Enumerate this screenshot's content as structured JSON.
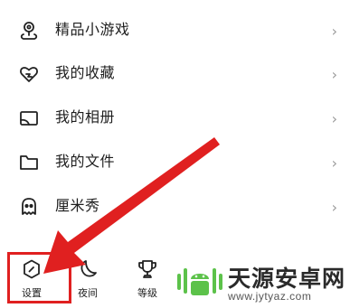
{
  "menu": {
    "items": [
      {
        "label": "精品小游戏",
        "icon": "game-pin-icon"
      },
      {
        "label": "我的收藏",
        "icon": "favorite-heart-icon"
      },
      {
        "label": "我的相册",
        "icon": "album-icon"
      },
      {
        "label": "我的文件",
        "icon": "folder-icon"
      },
      {
        "label": "厘米秀",
        "icon": "avatar-show-icon"
      }
    ],
    "chevron": "›"
  },
  "bottom_bar": {
    "settings_label": "设置",
    "night_label": "夜间",
    "level_label": "等级"
  },
  "watermark": {
    "title": "天源安卓网",
    "url": "www.jytyaz.com"
  },
  "colors": {
    "annotation_red": "#e02020",
    "logo_green": "#5cc24a"
  }
}
